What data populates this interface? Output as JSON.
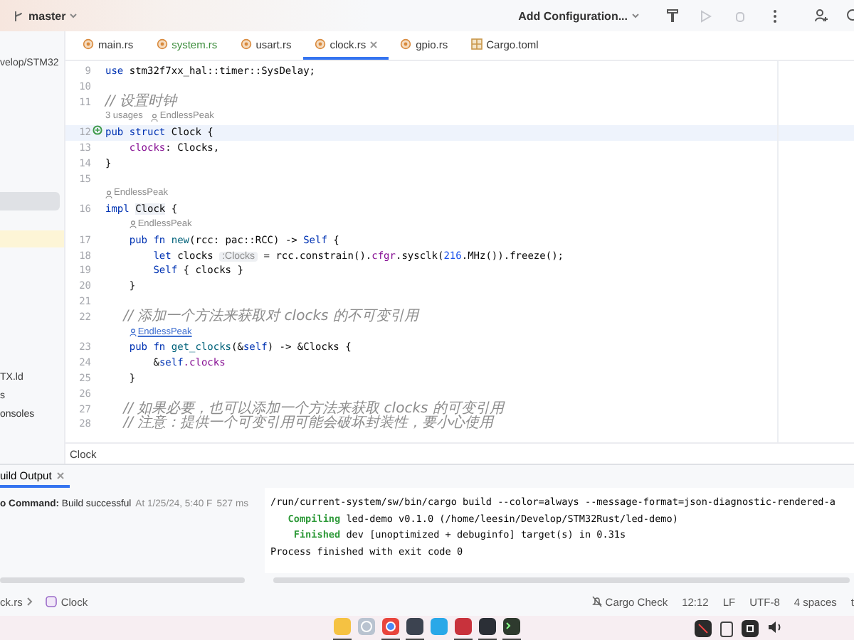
{
  "titlebar": {
    "branch": "master",
    "run_config": "Add Configuration...",
    "toolbar": [
      {
        "kind": "build",
        "disabled": false
      },
      {
        "kind": "run",
        "disabled": true
      },
      {
        "kind": "debug",
        "disabled": true
      },
      {
        "kind": "more",
        "disabled": false
      }
    ]
  },
  "sidebar": {
    "path": "velop/STM32",
    "items": [
      {
        "label": "TX.ld"
      },
      {
        "label": "s"
      },
      {
        "label": "onsoles"
      }
    ]
  },
  "tabs": [
    {
      "label": "main.rs",
      "kind": "rust",
      "color": "#3a3a3a",
      "selected": false
    },
    {
      "label": "system.rs",
      "kind": "rust",
      "color": "#3f8f3f",
      "selected": false
    },
    {
      "label": "usart.rs",
      "kind": "rust",
      "color": "#3a3a3a",
      "selected": false
    },
    {
      "label": "clock.rs",
      "kind": "rust",
      "color": "#3a3a3a",
      "selected": true
    },
    {
      "label": "gpio.rs",
      "kind": "rust",
      "color": "#3a3a3a",
      "selected": false
    },
    {
      "label": "Cargo.toml",
      "kind": "toml",
      "color": "#3a3a3a",
      "selected": false
    }
  ],
  "editor": {
    "rows": [
      {
        "kind": "code",
        "number": "9",
        "current": false,
        "marked": false,
        "segments": [
          {
            "text": "use ",
            "kind": "kw"
          },
          {
            "text": "stm32f7xx_hal::timer::SysDelay;",
            "kind": "plain"
          }
        ]
      },
      {
        "kind": "code",
        "number": "10",
        "current": false,
        "marked": false,
        "segments": []
      },
      {
        "kind": "code",
        "number": "11",
        "current": false,
        "marked": false,
        "segments": [
          {
            "text": "// 设置时钟",
            "kind": "comment"
          }
        ]
      },
      {
        "kind": "hint",
        "hovered": false,
        "parts": [
          {
            "text": "3 usages",
            "author": false
          },
          {
            "text": "EndlessPeak",
            "author": true
          }
        ]
      },
      {
        "kind": "code",
        "number": "12",
        "current": true,
        "marked": true,
        "segments": [
          {
            "text": "pub struct ",
            "kind": "kw"
          },
          {
            "text": "Clock {",
            "kind": "plain"
          }
        ]
      },
      {
        "kind": "code",
        "number": "13",
        "current": false,
        "marked": false,
        "segments": [
          {
            "text": "    clocks",
            "kind": "field"
          },
          {
            "text": ": Clocks,",
            "kind": "plain"
          }
        ]
      },
      {
        "kind": "code",
        "number": "14",
        "current": false,
        "marked": false,
        "segments": [
          {
            "text": "}",
            "kind": "plain"
          }
        ]
      },
      {
        "kind": "code",
        "number": "15",
        "current": false,
        "marked": false,
        "segments": []
      },
      {
        "kind": "hint",
        "hovered": false,
        "parts": [
          {
            "text": "EndlessPeak",
            "author": true
          }
        ]
      },
      {
        "kind": "code",
        "number": "16",
        "current": false,
        "marked": false,
        "segments": [
          {
            "text": "impl ",
            "kind": "kw"
          },
          {
            "text": "Clock",
            "kind": "type"
          },
          {
            "text": " {",
            "kind": "plain"
          }
        ]
      },
      {
        "kind": "hint",
        "hovered": false,
        "parts": [
          {
            "text": "EndlessPeak",
            "author": true
          }
        ]
      },
      {
        "kind": "code",
        "number": "17",
        "current": false,
        "marked": false,
        "segments": [
          {
            "text": "    pub fn ",
            "kind": "kw"
          },
          {
            "text": "new",
            "kind": "fn"
          },
          {
            "text": "(rcc: pac::RCC) -> ",
            "kind": "plain"
          },
          {
            "text": "Self",
            "kind": "kw"
          },
          {
            "text": " {",
            "kind": "plain"
          }
        ]
      },
      {
        "kind": "code",
        "number": "18",
        "current": false,
        "marked": false,
        "segments": [
          {
            "text": "        let ",
            "kind": "kw"
          },
          {
            "text": "clocks ",
            "kind": "plain"
          },
          {
            "text": ":Clocks",
            "kind": "inlay"
          },
          {
            "text": " = rcc.constrain().",
            "kind": "plain"
          },
          {
            "text": "cfgr",
            "kind": "field"
          },
          {
            "text": ".sysclk(",
            "kind": "plain"
          },
          {
            "text": "216",
            "kind": "num"
          },
          {
            "text": ".MHz()).freeze();",
            "kind": "plain"
          }
        ]
      },
      {
        "kind": "code",
        "number": "19",
        "current": false,
        "marked": false,
        "segments": [
          {
            "text": "        Self",
            "kind": "kw"
          },
          {
            "text": " { clocks }",
            "kind": "plain"
          }
        ]
      },
      {
        "kind": "code",
        "number": "20",
        "current": false,
        "marked": false,
        "segments": [
          {
            "text": "    }",
            "kind": "plain"
          }
        ]
      },
      {
        "kind": "code",
        "number": "21",
        "current": false,
        "marked": false,
        "segments": []
      },
      {
        "kind": "code",
        "number": "22",
        "current": false,
        "marked": false,
        "segments": [
          {
            "text": "    // 添加一个方法来获取对 clocks 的不可变引用",
            "kind": "comment"
          }
        ]
      },
      {
        "kind": "hint",
        "hovered": true,
        "parts": [
          {
            "text": "EndlessPeak",
            "author": true
          }
        ]
      },
      {
        "kind": "code",
        "number": "23",
        "current": false,
        "marked": false,
        "segments": [
          {
            "text": "    pub fn ",
            "kind": "kw"
          },
          {
            "text": "get_clocks",
            "kind": "fn"
          },
          {
            "text": "(&",
            "kind": "plain"
          },
          {
            "text": "self",
            "kind": "kw"
          },
          {
            "text": ") -> &Clocks {",
            "kind": "plain"
          }
        ]
      },
      {
        "kind": "code",
        "number": "24",
        "current": false,
        "marked": false,
        "segments": [
          {
            "text": "        &",
            "kind": "plain"
          },
          {
            "text": "self",
            "kind": "kw"
          },
          {
            "text": ".clocks",
            "kind": "field"
          }
        ]
      },
      {
        "kind": "code",
        "number": "25",
        "current": false,
        "marked": false,
        "segments": [
          {
            "text": "    }",
            "kind": "plain"
          }
        ]
      },
      {
        "kind": "code",
        "number": "26",
        "current": false,
        "marked": false,
        "segments": []
      },
      {
        "kind": "code",
        "number": "27",
        "current": false,
        "marked": false,
        "segments": [
          {
            "text": "    // 如果必要，也可以添加一个方法来获取 clocks 的可变引用",
            "kind": "comment"
          }
        ]
      },
      {
        "kind": "code",
        "number": "28",
        "current": false,
        "marked": false,
        "segments": [
          {
            "text": "    // 注意：提供一个可变引用可能会破坏封装性，要小心使用",
            "kind": "comment"
          }
        ]
      }
    ],
    "breadcrumb": "Clock"
  },
  "build": {
    "tab": "uild Output",
    "summary": "**o Command:** Build successful",
    "time": "At 1/25/24, 5:40 F",
    "duration": "527 ms",
    "console": [
      [
        {
          "text": "/run/current-system/sw/bin/cargo build --color=always --message-format=json-diagnostic-rendered-a",
          "kind": "plain"
        }
      ],
      [
        {
          "text": "   Compiling",
          "kind": "ok"
        },
        {
          "text": " led-demo v0.1.0 (/home/leesin/Develop/STM32Rust/led-demo)",
          "kind": "plain"
        }
      ],
      [
        {
          "text": "    Finished",
          "kind": "ok"
        },
        {
          "text": " dev [unoptimized + debuginfo] target(s) in 0.31s",
          "kind": "plain"
        }
      ],
      [
        {
          "text": "Process finished with exit code 0",
          "kind": "plain"
        }
      ]
    ]
  },
  "status_bar": {
    "breadcrumb": [
      "ck.rs",
      "Clock"
    ],
    "items": [
      {
        "kind": "cargo",
        "text": "Cargo Check"
      },
      {
        "kind": "text",
        "text": "12:12"
      },
      {
        "kind": "text",
        "text": "LF"
      },
      {
        "kind": "text",
        "text": "UTF-8"
      },
      {
        "kind": "text",
        "text": "4 spaces"
      },
      {
        "kind": "text",
        "text": "t"
      }
    ]
  },
  "dock": [
    {
      "kind": "folder",
      "running": true
    },
    {
      "kind": "settings",
      "running": false
    },
    {
      "kind": "browser",
      "running": true
    },
    {
      "kind": "editor",
      "running": true
    },
    {
      "kind": "terminal-blue",
      "running": false
    },
    {
      "kind": "game",
      "running": true
    },
    {
      "kind": "ide",
      "running": true
    },
    {
      "kind": "console",
      "running": true
    }
  ]
}
